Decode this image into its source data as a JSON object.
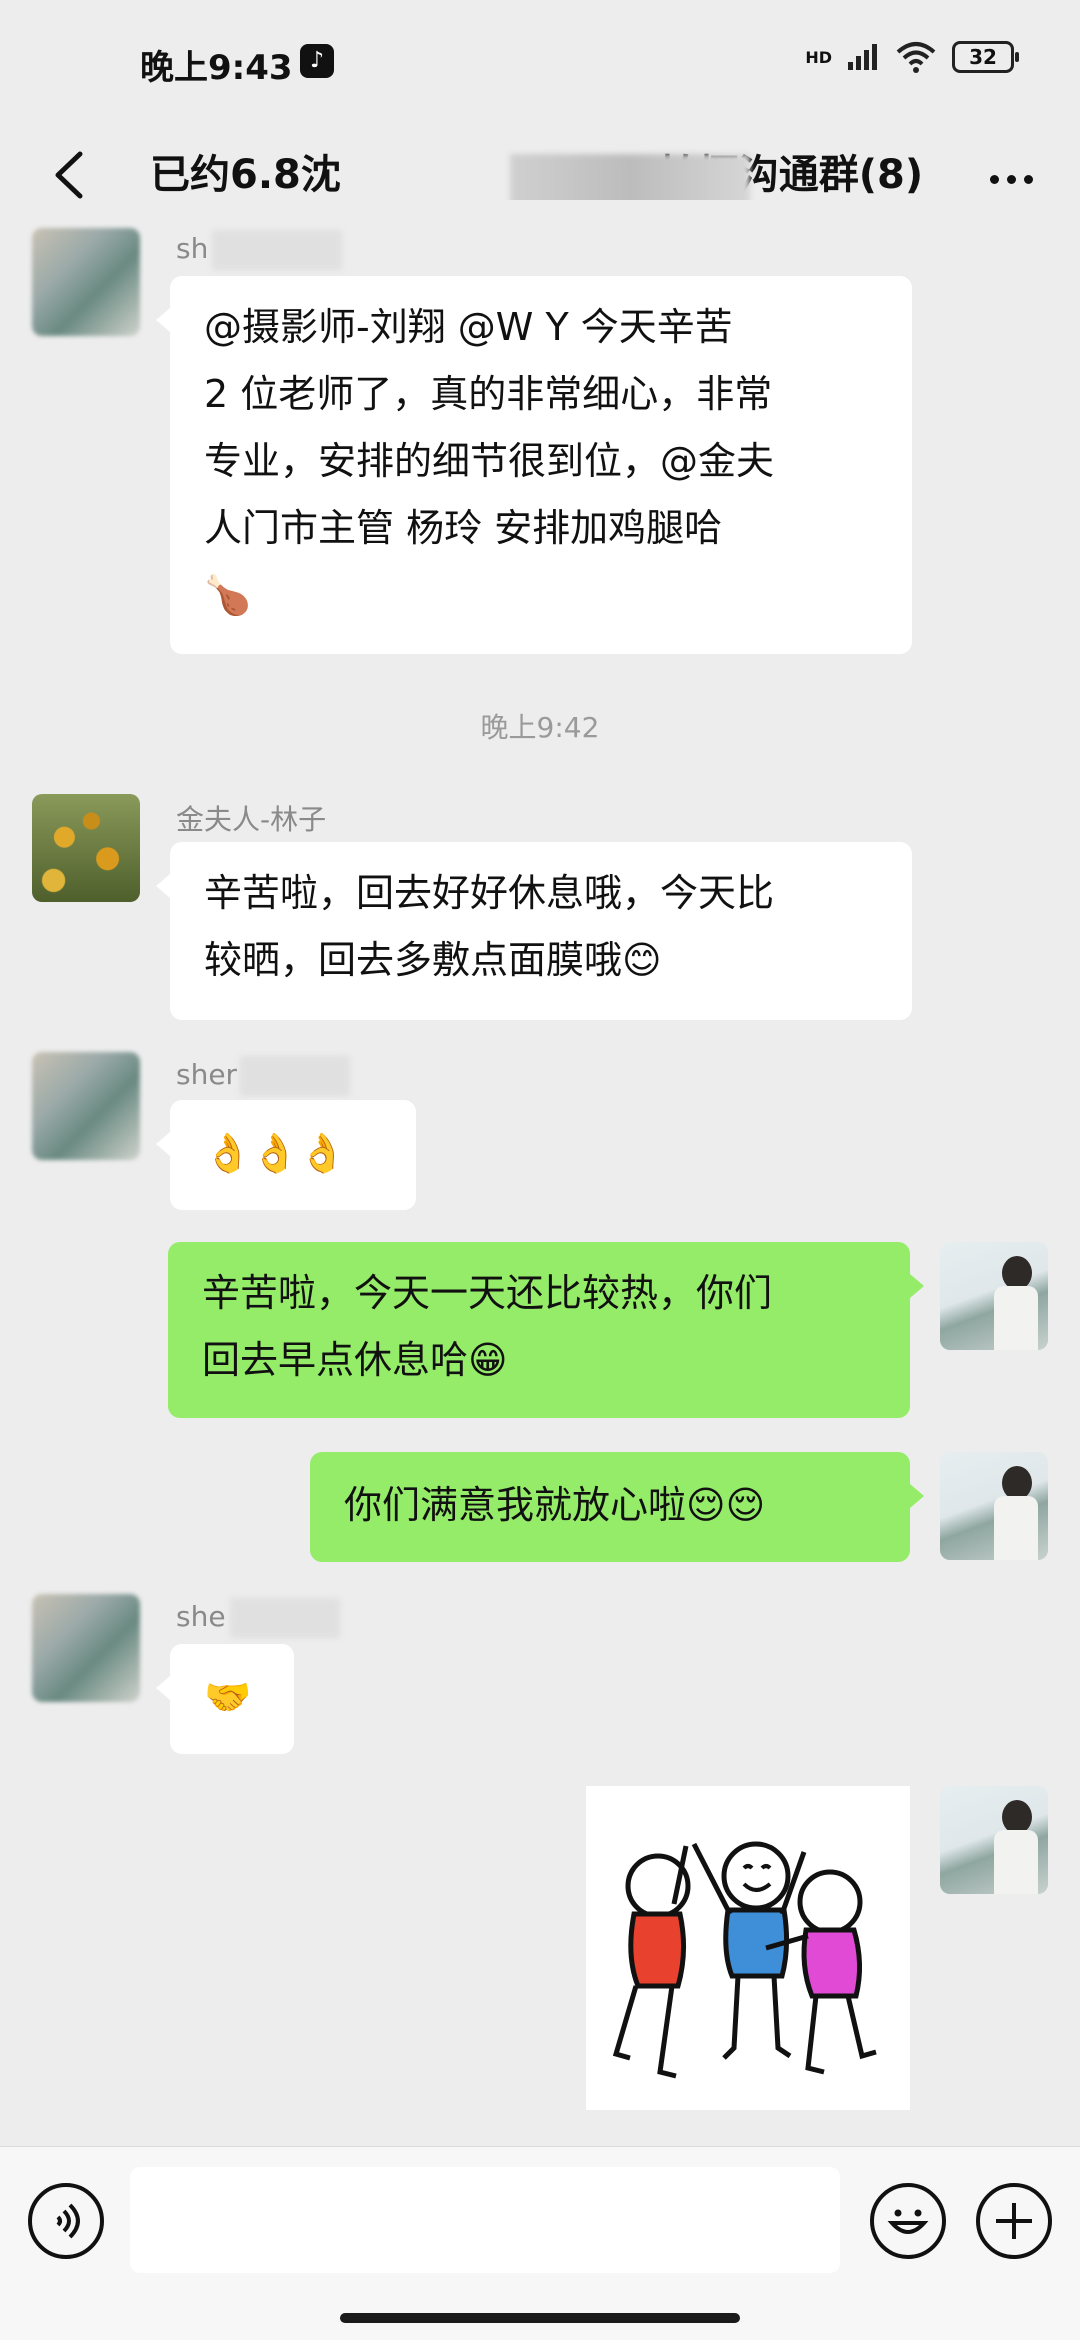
{
  "status_bar": {
    "time": "晚上9:43",
    "network": "HD",
    "battery": "32"
  },
  "header": {
    "title": "已约6.8沈",
    "title_suffix": "拍摄沟通群(8)"
  },
  "messages": [
    {
      "sender": "sh",
      "text_lines": [
        "@摄影师-刘翔  @W Y  今天辛苦",
        "2 位老师了，真的非常细心，非常",
        "专业，安排的细节很到位，@金夫",
        "人门市主管  杨玲   安排加鸡腿哈"
      ],
      "emoji": "🍗"
    },
    {
      "timestamp": "晚上9:42"
    },
    {
      "sender": "金夫人-林子",
      "text_lines": [
        "辛苦啦，回去好好休息哦，今天比",
        "较晒，回去多敷点面膜哦😊"
      ]
    },
    {
      "sender": "sher",
      "text": "👌👌👌"
    },
    {
      "self": true,
      "text_lines": [
        "辛苦啦，今天一天还比较热，你们",
        "回去早点休息哈😁"
      ]
    },
    {
      "self": true,
      "text": "你们满意我就放心啦😌😌"
    },
    {
      "sender": "she",
      "text": "🤝"
    },
    {
      "self": true,
      "sticker": "high-five-sticker"
    }
  ],
  "colors": {
    "background": "#ededed",
    "self_bubble": "#95ec69",
    "other_bubble": "#ffffff"
  }
}
